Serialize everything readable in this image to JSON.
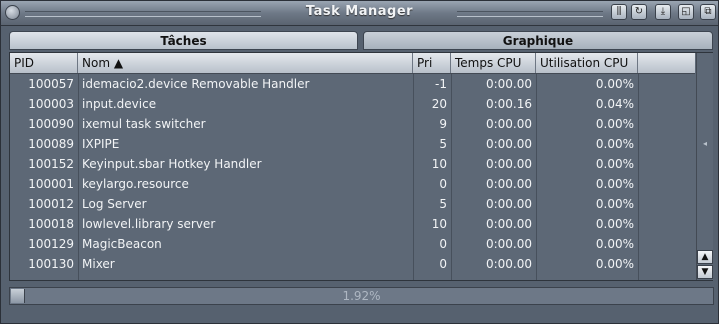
{
  "window": {
    "title": "Task Manager"
  },
  "tabs": [
    {
      "label": "Tâches",
      "active": true
    },
    {
      "label": "Graphique",
      "active": false
    }
  ],
  "columns": [
    "PID",
    "Nom ▲",
    "Pri",
    "Temps CPU",
    "Utilisation CPU"
  ],
  "processes": [
    {
      "pid": "100057",
      "name": "idemacio2.device Removable Handler",
      "pri": "-1",
      "time": "0:00.00",
      "cpu": "0.00%"
    },
    {
      "pid": "100003",
      "name": "input.device",
      "pri": "20",
      "time": "0:00.16",
      "cpu": "0.04%"
    },
    {
      "pid": "100090",
      "name": "ixemul task switcher",
      "pri": "9",
      "time": "0:00.00",
      "cpu": "0.00%"
    },
    {
      "pid": "100089",
      "name": "IXPIPE",
      "pri": "5",
      "time": "0:00.00",
      "cpu": "0.00%"
    },
    {
      "pid": "100152",
      "name": "Keyinput.sbar Hotkey Handler",
      "pri": "10",
      "time": "0:00.00",
      "cpu": "0.00%"
    },
    {
      "pid": "100001",
      "name": "keylargo.resource",
      "pri": "0",
      "time": "0:00.00",
      "cpu": "0.00%"
    },
    {
      "pid": "100012",
      "name": "Log Server",
      "pri": "5",
      "time": "0:00.00",
      "cpu": "0.00%"
    },
    {
      "pid": "100018",
      "name": "lowlevel.library server",
      "pri": "10",
      "time": "0:00.00",
      "cpu": "0.00%"
    },
    {
      "pid": "100129",
      "name": "MagicBeacon",
      "pri": "0",
      "time": "0:00.00",
      "cpu": "0.00%"
    },
    {
      "pid": "100130",
      "name": "Mixer",
      "pri": "0",
      "time": "0:00.00",
      "cpu": "0.00%"
    }
  ],
  "cpu_usage": {
    "label": "1.92%",
    "fraction": 0.0192
  },
  "colors": {
    "window_bg": "#56616f",
    "header_bg": "#cfd5dc",
    "text": "#f2f4f6"
  },
  "icons": [
    "close-icon",
    "iconify-icon",
    "snapshot-icon",
    "jump-icon",
    "zoom-icon",
    "depth-icon",
    "scroll-up-icon",
    "scroll-down-icon"
  ]
}
